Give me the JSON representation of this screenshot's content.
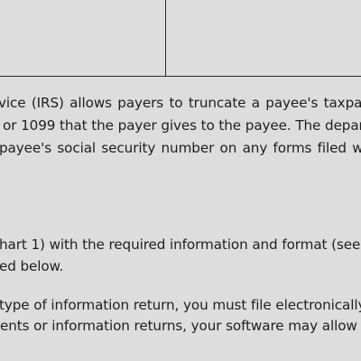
{
  "document": {
    "form_table": {
      "cells": [
        "",
        ""
      ]
    },
    "paragraph_1": {
      "lines": [
        "vice (IRS) allows payers to truncate a payee's taxpayer",
        "or 1099 that the payer gives to the payee. The department",
        "payee's social security number on any forms filed with the"
      ]
    },
    "paragraph_2": {
      "lines": [
        "hart 1) with the required information and format (see",
        "ed below."
      ]
    },
    "paragraph_3": {
      "lines": [
        "type of information return, you must file electronically.",
        "ents or information returns, your software may allow"
      ]
    }
  }
}
